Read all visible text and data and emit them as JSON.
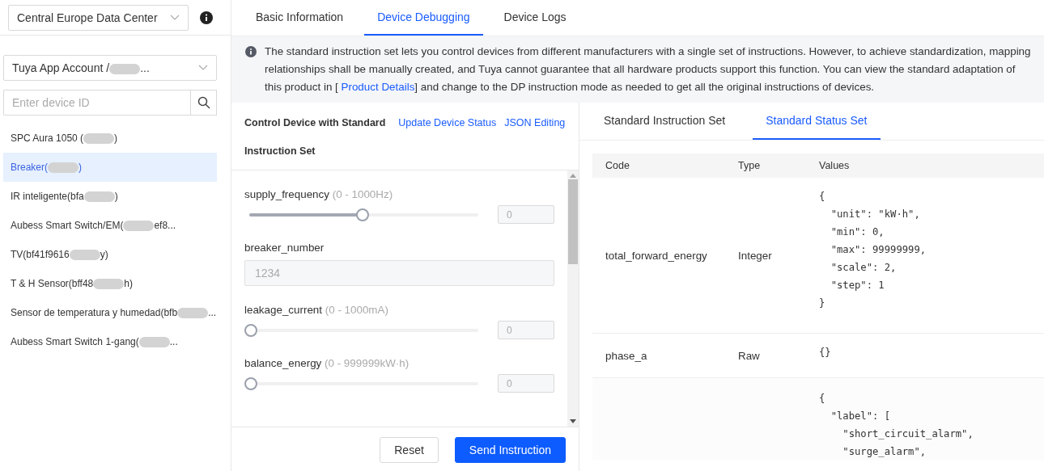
{
  "sidebar": {
    "region_select": {
      "value": "Central Europe Data Center"
    },
    "account_select": {
      "value": "Tuya App Account /",
      "value_end": "..."
    },
    "search": {
      "placeholder": "Enter device ID"
    },
    "devices": [
      {
        "name": "SPC Aura 1050 (",
        "name_end": ")",
        "selected": false
      },
      {
        "name": "Breaker(",
        "name_end": ")",
        "selected": true
      },
      {
        "name": "IR inteligente(bfa",
        "name_end": ")",
        "selected": false
      },
      {
        "name": "Aubess Smart Switch/EM(",
        "name_end": "ef8...",
        "selected": false
      },
      {
        "name": "TV(bf41f9616",
        "name_end": "y)",
        "selected": false
      },
      {
        "name": "T & H Sensor(bff48",
        "name_end": "h)",
        "selected": false
      },
      {
        "name": "Sensor de temperatura y humedad(bfb",
        "name_end": "...",
        "selected": false
      },
      {
        "name": "Aubess Smart Switch 1-gang(",
        "name_end": "...",
        "selected": false
      }
    ]
  },
  "tabs": [
    {
      "label": "Basic Information",
      "selected": false
    },
    {
      "label": "Device Debugging",
      "selected": true
    },
    {
      "label": "Device Logs",
      "selected": false
    }
  ],
  "notice": {
    "text": "The standard instruction set lets you control devices from different manufacturers with a single set of instructions. However, to achieve standardization, mapping relationships shall be manually created, and Tuya cannot guarantee that all hardware products support this function. You can view the standard adaptation of this product in [",
    "link": "Product Details",
    "text_end": "] and change to the DP instruction mode as needed to get all the original instructions of devices."
  },
  "control": {
    "title": "Control Device with Standard",
    "links": [
      "Update Device Status",
      "JSON Editing"
    ],
    "subtitle": "Instruction Set",
    "instructions": [
      {
        "kind": "slider",
        "label": "supply_frequency",
        "range": "(0 - 1000Hz)",
        "level": 0.5,
        "value": "0"
      },
      {
        "kind": "input",
        "label": "breaker_number",
        "value": "1234"
      },
      {
        "kind": "slider",
        "label": "leakage_current",
        "range": "(0 - 1000mA)",
        "level": 0,
        "value": "0"
      },
      {
        "kind": "slider",
        "label": "balance_energy",
        "range": "(0 - 999999kW·h)",
        "level": 0,
        "value": "0"
      }
    ],
    "buttons": [
      {
        "label": "Reset",
        "kind": "default"
      },
      {
        "label": "Send Instruction",
        "kind": "primary"
      }
    ]
  },
  "status": {
    "tabs": [
      {
        "label": "Standard Instruction Set",
        "selected": false
      },
      {
        "label": "Standard Status Set",
        "selected": true
      }
    ],
    "table": {
      "columns": [
        "Code",
        "Type",
        "Values"
      ],
      "rows": [
        {
          "code": "total_forward_energy",
          "type": "Integer",
          "values": "{\n  \"unit\": \"kW·h\",\n  \"min\": 0,\n  \"max\": 99999999,\n  \"scale\": 2,\n  \"step\": 1\n}"
        },
        {
          "code": "phase_a",
          "type": "Raw",
          "values": "{}"
        },
        {
          "values": "{\n  \"label\": [\n    \"short_circuit_alarm\",\n    \"surge_alarm\","
        }
      ]
    }
  }
}
